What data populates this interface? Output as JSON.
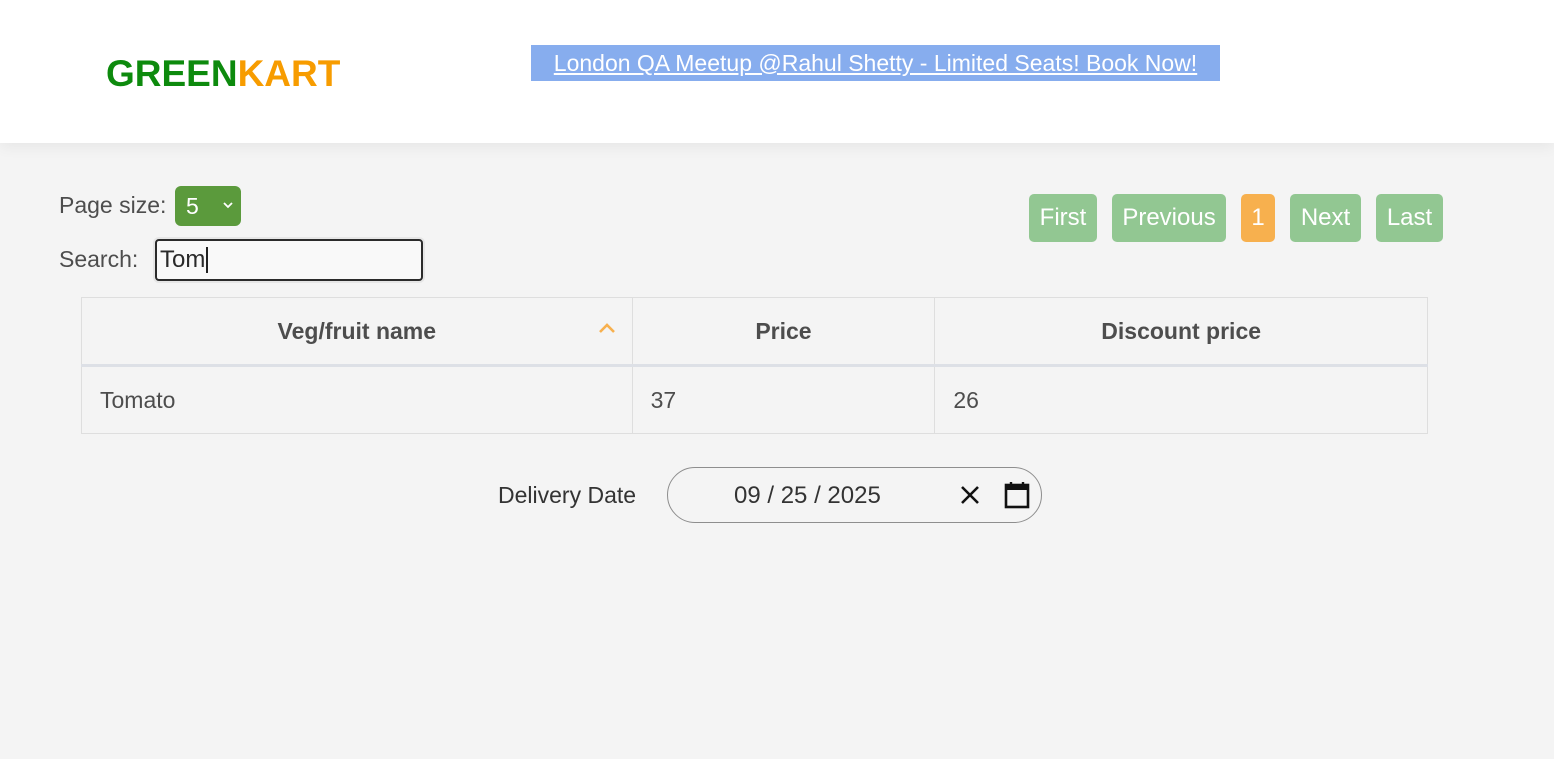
{
  "header": {
    "brand_green": "GREEN",
    "brand_kart": "KART",
    "promo_link": "London QA Meetup @Rahul Shetty - Limited Seats! Book Now!"
  },
  "controls": {
    "page_size_label": "Page size:",
    "page_size_value": "5",
    "search_label": "Search:",
    "search_value": "Tom"
  },
  "pagination": {
    "first": "First",
    "previous": "Previous",
    "current_page": "1",
    "next": "Next",
    "last": "Last"
  },
  "table": {
    "columns": [
      "Veg/fruit name",
      "Price",
      "Discount price"
    ],
    "sorted_column": "Veg/fruit name",
    "sort_direction": "ascending",
    "rows": [
      [
        "Tomato",
        "37",
        "26"
      ]
    ]
  },
  "delivery": {
    "label": "Delivery Date",
    "value": "09 / 25 / 2025"
  },
  "colors": {
    "brand_green": "#0d8a0d",
    "brand_orange": "#f79c00",
    "pager_button": "#92c792",
    "pager_active": "#f7b04e",
    "page_size_select": "#5b9a3c",
    "promo_background": "#87adee"
  }
}
